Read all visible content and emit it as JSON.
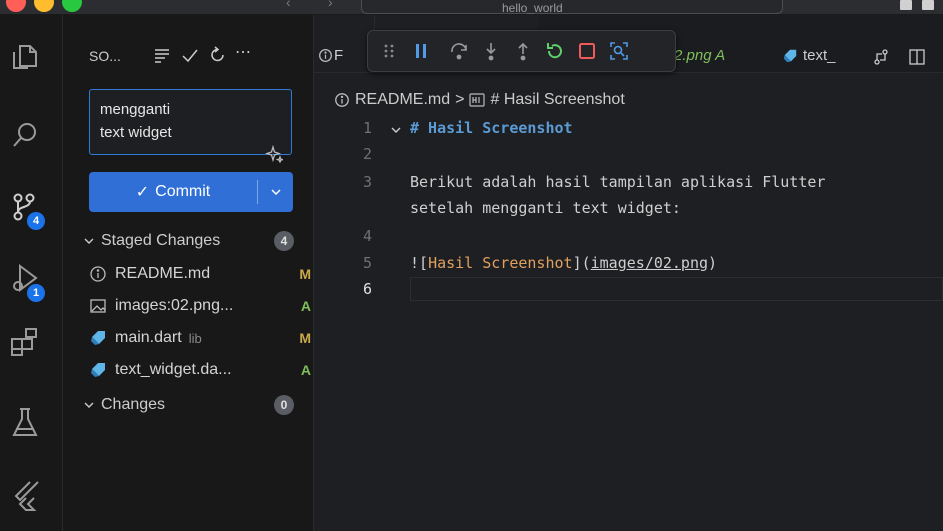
{
  "window": {
    "title": "hello_world",
    "traffic_lights": [
      "#ff5f57",
      "#febc2e",
      "#28c840"
    ]
  },
  "activity_bar": {
    "items": [
      {
        "icon": "explorer-icon"
      },
      {
        "icon": "search-icon"
      },
      {
        "icon": "source-control-icon",
        "badge": "4"
      },
      {
        "icon": "run-debug-icon",
        "badge": "1"
      },
      {
        "icon": "extensions-icon"
      },
      {
        "icon": "testing-icon"
      },
      {
        "icon": "flutter-icon"
      }
    ]
  },
  "sidebar": {
    "title": "SO...",
    "commit_message": "mengganti\ntext widget",
    "commit_button_label": "Commit",
    "staged": {
      "label": "Staged Changes",
      "count": "4",
      "files": [
        {
          "name": "README.md",
          "dir": "",
          "status": "M",
          "icon": "info-icon"
        },
        {
          "name": "images:02.png...",
          "dir": "",
          "status": "A",
          "icon": "image-file-icon"
        },
        {
          "name": "main.dart",
          "dir": "lib",
          "status": "M",
          "icon": "dart-icon"
        },
        {
          "name": "text_widget.da...",
          "dir": "",
          "status": "A",
          "icon": "dart-icon"
        }
      ]
    },
    "changes": {
      "label": "Changes",
      "count": "0"
    }
  },
  "tabs": {
    "readme_label": "F",
    "png_label": "2.png A",
    "text_label": "text_"
  },
  "breadcrumb": {
    "file": "README.md",
    "separator": ">",
    "symbol": "# Hasil Screenshot"
  },
  "editor": {
    "lines": [
      {
        "num": "1",
        "text": "# Hasil Screenshot"
      },
      {
        "num": "2",
        "text": ""
      },
      {
        "num": "3",
        "text": "Berikut adalah hasil tampilan aplikasi Flutter"
      },
      {
        "num": "",
        "text": "setelah mengganti text widget:"
      },
      {
        "num": "4",
        "text": ""
      },
      {
        "num": "5",
        "link_text": "Hasil Screenshot",
        "link_url": "images/02.png"
      },
      {
        "num": "6",
        "text": ""
      }
    ]
  },
  "colors": {
    "accent": "#2f6fd6",
    "modified": "#c9a94a",
    "added": "#7fbf5a"
  }
}
